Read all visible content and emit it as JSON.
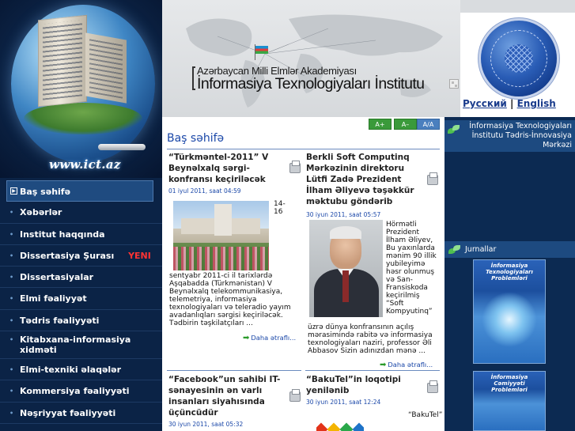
{
  "logo": {
    "site": "www.ict.az"
  },
  "header": {
    "academy": "Azərbaycan Milli Elmlər Akademiyası",
    "institute": "İnformasiya Texnologiyaları İnstitutu"
  },
  "lang": {
    "russian": "Русский",
    "separator": "|",
    "english": "English"
  },
  "sidebar": {
    "items": [
      {
        "label": "Baş səhifə",
        "active": true
      },
      {
        "label": "Xəbərlər"
      },
      {
        "label": "Institut haqqında"
      },
      {
        "label": "Dissertasiya Şurası",
        "badge": "YENI"
      },
      {
        "label": "Dissertasiyalar"
      },
      {
        "label": "Elmi fəaliyyət"
      },
      {
        "label": "Tədris fəaliyyəti"
      },
      {
        "label": "Kitabxana-informasiya xidməti"
      },
      {
        "label": "Elmi-texniki əlaqələr"
      },
      {
        "label": "Kommersiya fəaliyyəti"
      },
      {
        "label": "Nəşriyyat fəaliyyəti"
      }
    ]
  },
  "font_controls": {
    "increase": "A+",
    "decrease": "A–",
    "reset": "A/A"
  },
  "page_title": "Baş səhifə",
  "news": [
    {
      "title": "“Türkməntel-2011” V Beynəlxalq sərgi-konfransı keçiriləcək",
      "date": "01 iyul 2011, saat 04:59",
      "lead": "14-16",
      "body": "sentyabr 2011-ci il tarixlərdə Aşqabadda (Türkmənistan) V Beynəlxalq telekommunikasiya, telemetriya, informasiya texnologiyaları və teleradio yayım avadanlıqları sərgisi keçiriləcək. Tədbirin təşkilatçıları ...",
      "more": "Daha ətraflı..."
    },
    {
      "title": "Berkli Soft Computinq Mərkəzinin direktoru Lütfi Zadə Prezident İlham Əliyevə təşəkkür məktubu göndərib",
      "date": "30 iyun 2011, saat 05:57",
      "side": "Hörmətli Prezident İlham Əliyev, Bu yaxınlarda mənim 90 illik yubileyimə həsr olunmuş və San-Fransiskoda keçirilmiş “Soft Kompyutinq”",
      "body": "üzrə dünya konfransının açılış mərasimində rabitə və informasiya texnologiyaları naziri, professor Əli Abbasov Sizin adınızdan mənə ...",
      "more": "Daha ətraflı..."
    },
    {
      "title": "“Facebook”un sahibi IT-sənayesinin ən varlı insanları siyahısında üçüncüdür",
      "date": "30 iyun 2011, saat 05:32"
    },
    {
      "title": "“BakuTel”in loqotipi yenilənib",
      "date": "30 iyun 2011, saat 12:24",
      "lead": "“BakuTel”"
    }
  ],
  "right_panel": {
    "center_title": "İnformasiya Texnologiyaları İnstitutu Tədris-İnnovasiya Mərkəzi",
    "journals_title": "Jurnallar",
    "journal1": "İnformasiya Texnologiyaları Problemləri",
    "journal2": "İnformasiya Cəmiyyəti Problemləri"
  },
  "colors": {
    "sidebar_bg": "#0b2346",
    "accent_blue": "#1a47a8",
    "new_badge": "#ff3333",
    "font_button_green": "#3a9a3a"
  }
}
